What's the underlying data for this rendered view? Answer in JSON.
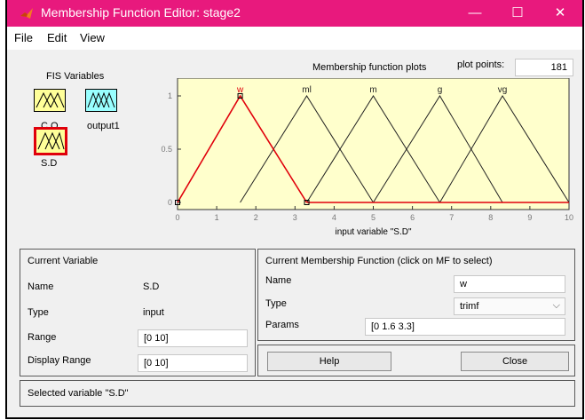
{
  "window": {
    "title": "Membership Function Editor: stage2",
    "controls": [
      "—",
      "☐",
      "✕"
    ]
  },
  "menu": [
    "File",
    "Edit",
    "View"
  ],
  "fis": {
    "header": "FIS Variables",
    "vars": [
      "C.Q",
      "output1",
      "S.D"
    ]
  },
  "plot": {
    "title": "Membership function plots",
    "points_label": "plot points:",
    "points_value": "181",
    "xlabel": "input variable \"S.D\"",
    "colors": {
      "selected": "#e0000b",
      "normal": "#222222"
    }
  },
  "chart_data": {
    "type": "line",
    "xlim": [
      0,
      10
    ],
    "ylim": [
      0,
      1
    ],
    "x_ticks": [
      "0",
      "1",
      "2",
      "3",
      "4",
      "5",
      "6",
      "7",
      "8",
      "9",
      "10"
    ],
    "y_ticks": [
      "0",
      "0.5",
      "1"
    ],
    "series": [
      {
        "name": "w",
        "x": [
          0,
          1.6,
          3.3
        ],
        "y": [
          0,
          1,
          0
        ],
        "selected": true
      },
      {
        "name": "ml",
        "x": [
          1.6,
          3.3,
          5
        ],
        "y": [
          0,
          1,
          0
        ]
      },
      {
        "name": "m",
        "x": [
          3.3,
          5,
          6.7
        ],
        "y": [
          0,
          1,
          0
        ]
      },
      {
        "name": "g",
        "x": [
          5,
          6.7,
          8.3
        ],
        "y": [
          0,
          1,
          0
        ]
      },
      {
        "name": "vg",
        "x": [
          6.7,
          8.3,
          10
        ],
        "y": [
          0,
          1,
          0
        ]
      }
    ]
  },
  "current_variable": {
    "header": "Current Variable",
    "name_label": "Name",
    "name_value": "S.D",
    "type_label": "Type",
    "type_value": "input",
    "range_label": "Range",
    "range_value": "[0 10]",
    "display_range_label": "Display Range",
    "display_range_value": "[0 10]"
  },
  "current_mf": {
    "header": "Current Membership Function (click on MF to select)",
    "name_label": "Name",
    "name_value": "w",
    "type_label": "Type",
    "type_value": "trimf",
    "params_label": "Params",
    "params_value": "[0 1.6 3.3]"
  },
  "buttons": {
    "help": "Help",
    "close": "Close"
  },
  "status": "Selected variable \"S.D\""
}
